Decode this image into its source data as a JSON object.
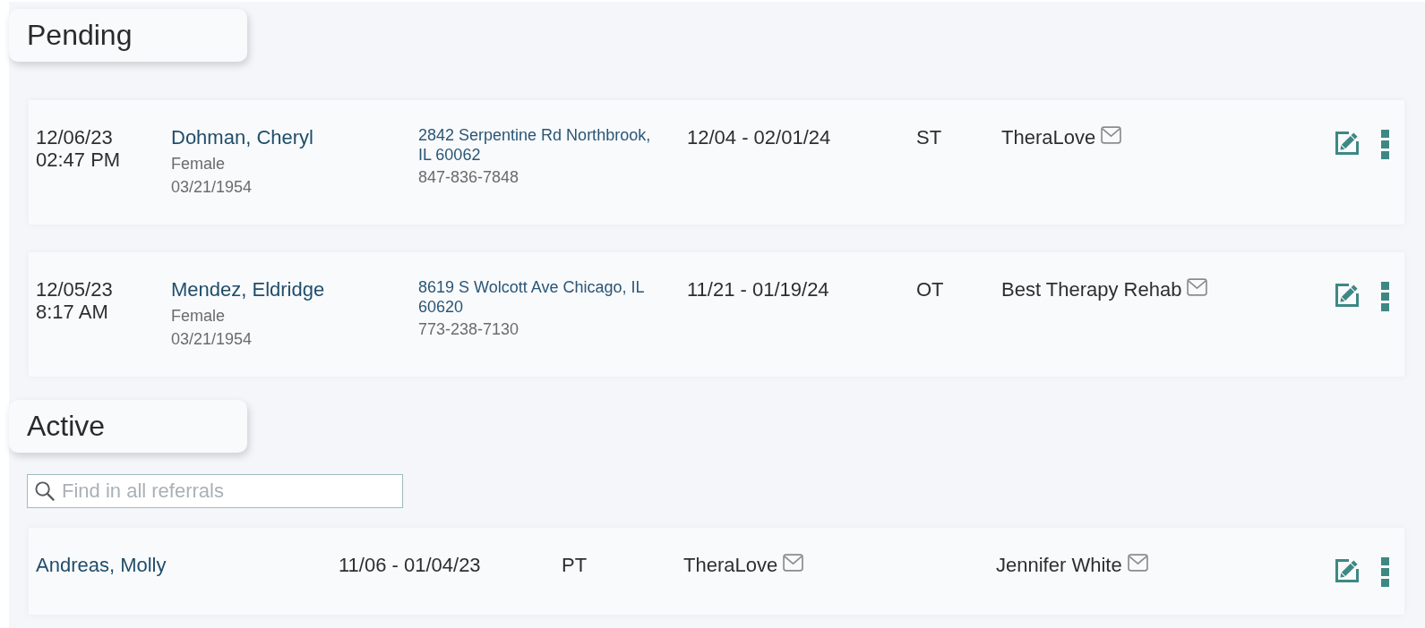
{
  "sections": [
    {
      "title": "Pending",
      "kind": "pending",
      "rows": [
        {
          "received_date": "12/06/23",
          "received_time": "02:47 PM",
          "patient_name": "Dohman, Cheryl",
          "sex": "Female",
          "birth_date": "03/21/1954",
          "address": "2842 Serpentine Rd Northbrook, IL 60062",
          "phone": "847-836-7848",
          "dates": "12/04 - 02/01/24",
          "discipline": "ST",
          "agency": "TheraLove"
        },
        {
          "received_date": "12/05/23",
          "received_time": "8:17 AM",
          "patient_name": "Mendez, Eldridge",
          "sex": "Female",
          "birth_date": "03/21/1954",
          "address": "8619 S Wolcott Ave Chicago, IL 60620",
          "phone": "773-238-7130",
          "dates": "11/21 - 01/19/24",
          "discipline": "OT",
          "agency": "Best Therapy Rehab"
        }
      ]
    },
    {
      "title": "Active",
      "kind": "active",
      "search": {
        "placeholder": "Find in all referrals"
      },
      "rows": [
        {
          "patient_name": "Andreas, Molly",
          "dates": "11/06 - 01/04/23",
          "discipline": "PT",
          "agency": "TheraLove",
          "clinician": "Jennifer White"
        }
      ]
    }
  ]
}
